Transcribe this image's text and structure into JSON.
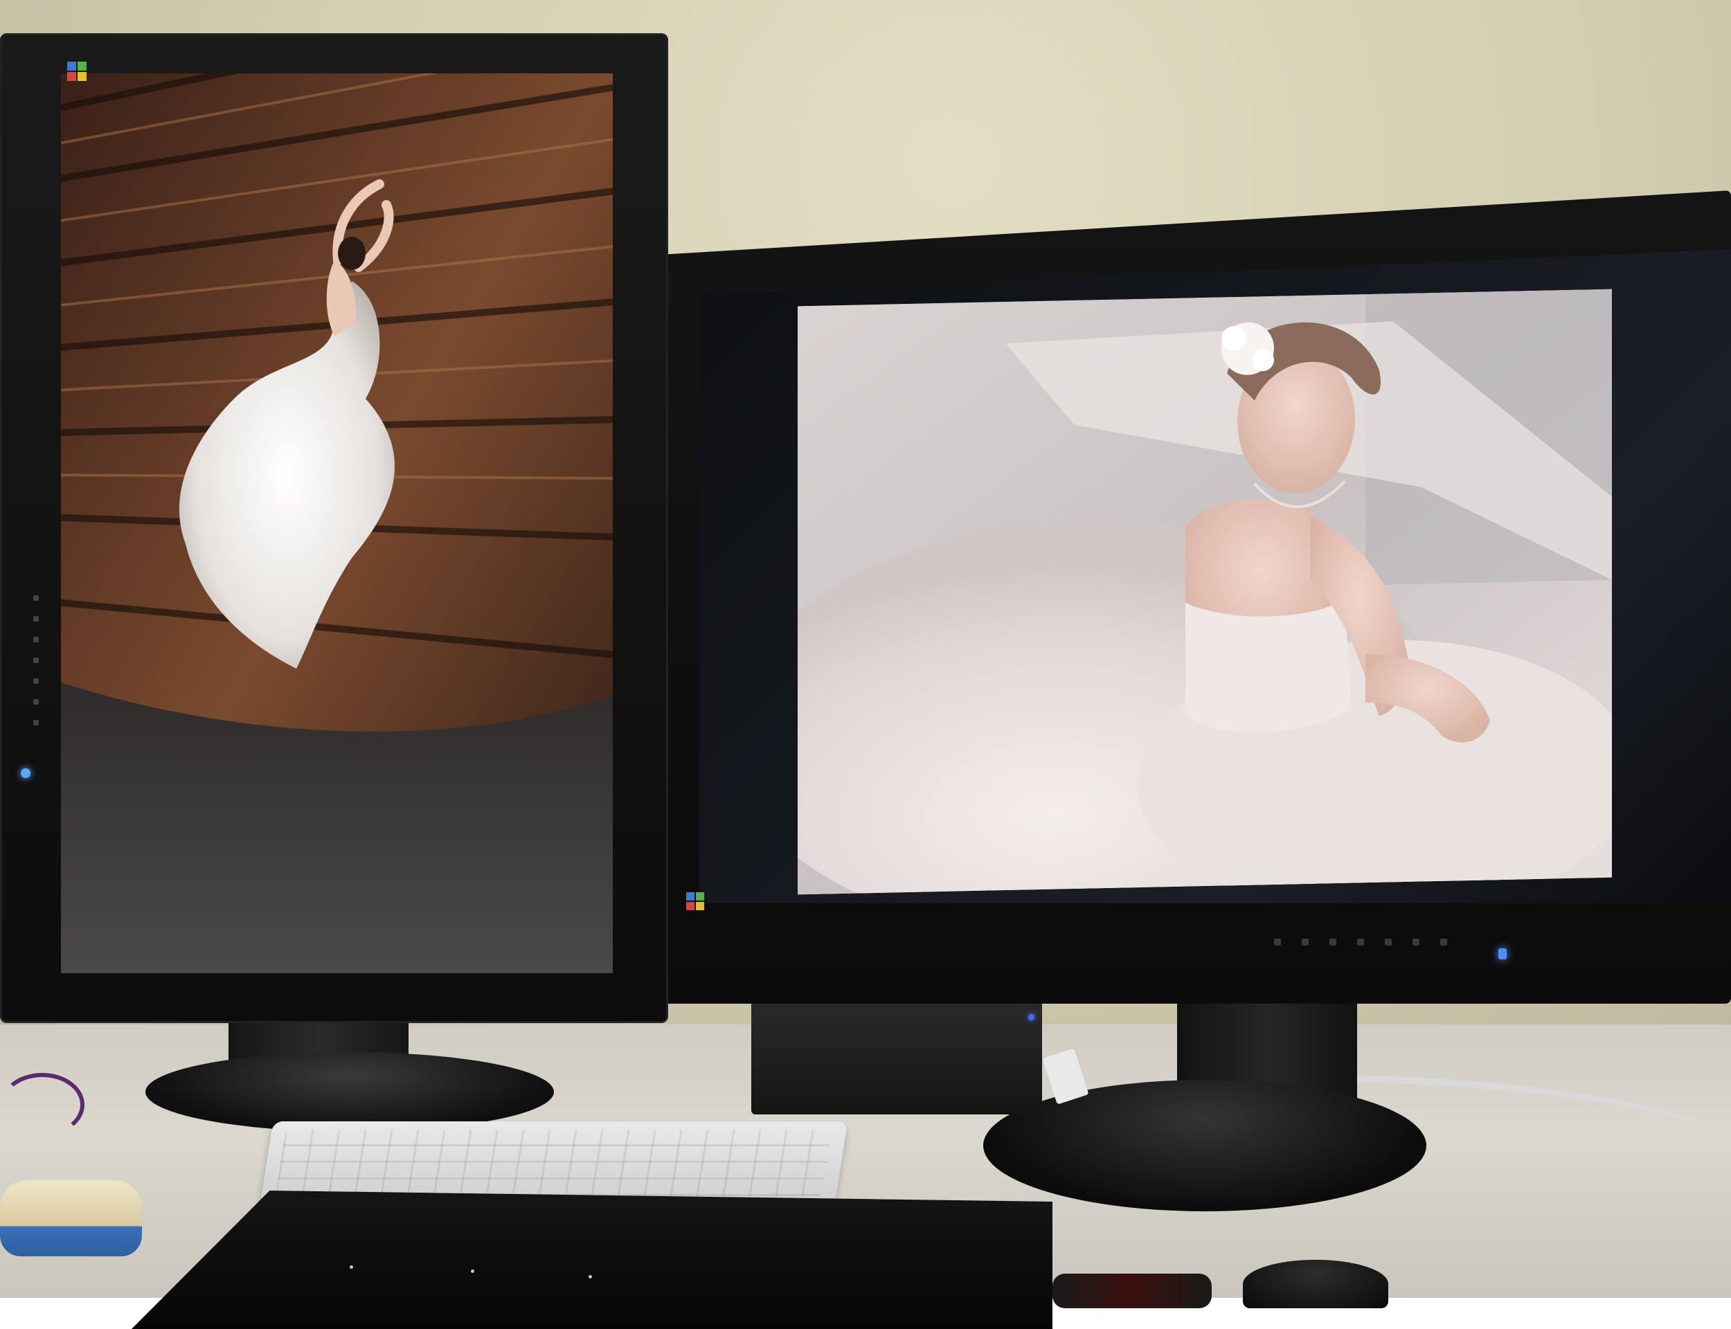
{
  "scene": {
    "description_note": "",
    "left_monitor": {
      "orientation": "portrait",
      "photo_theme": "bride-in-white-gown-wooden-ceiling"
    },
    "right_monitor": {
      "orientation": "landscape",
      "photo_theme": "bride-seated-white-gown"
    },
    "led_color": "#4f8dff",
    "wall_color": "#d4cfb2",
    "desk_color": "#d6d4ca"
  }
}
